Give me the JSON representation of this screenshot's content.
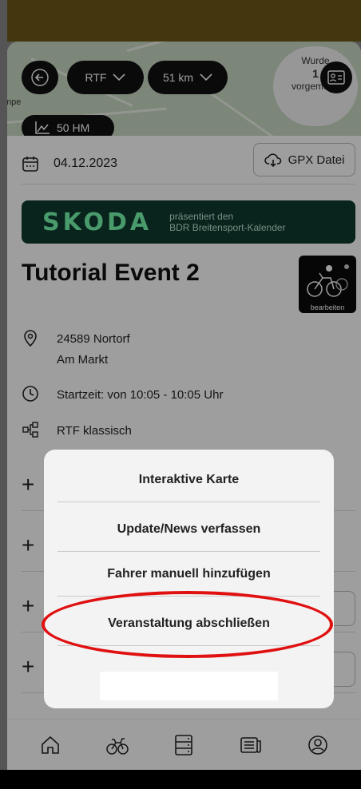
{
  "map": {
    "place_label": "mpe",
    "filter_type": "RTF",
    "distance": "51 km",
    "elevation": "50 HM",
    "reported": {
      "line1": "Wurde",
      "count": "1",
      "line2": "vorgemerkt"
    }
  },
  "event": {
    "date": "04.12.2023",
    "gpx_label": "GPX Datei",
    "sponsor": {
      "brand": "SKODA",
      "line1": "präsentiert den",
      "line2": "BDR Breitensport-Kalender"
    },
    "title": "Tutorial Event 2",
    "logo_caption": "bearbeiten",
    "zip_city": "24589 Nortorf",
    "street": "Am Markt",
    "start_time": "Startzeit: von 10:05 - 10:05 Uhr",
    "category": "RTF klassisch"
  },
  "action_sheet": {
    "items": [
      "Interaktive Karte",
      "Update/News verfassen",
      "Fahrer manuell hinzufügen",
      "Veranstaltung abschließen"
    ]
  },
  "nav": {
    "items": [
      "home-icon",
      "cyclist-icon",
      "list-icon",
      "news-icon",
      "profile-icon"
    ]
  },
  "colors": {
    "sponsor_bg": "#0e3a2f",
    "sponsor_brand": "#78faae",
    "highlight": "#e01010",
    "status_strip": "#6f5a17"
  }
}
